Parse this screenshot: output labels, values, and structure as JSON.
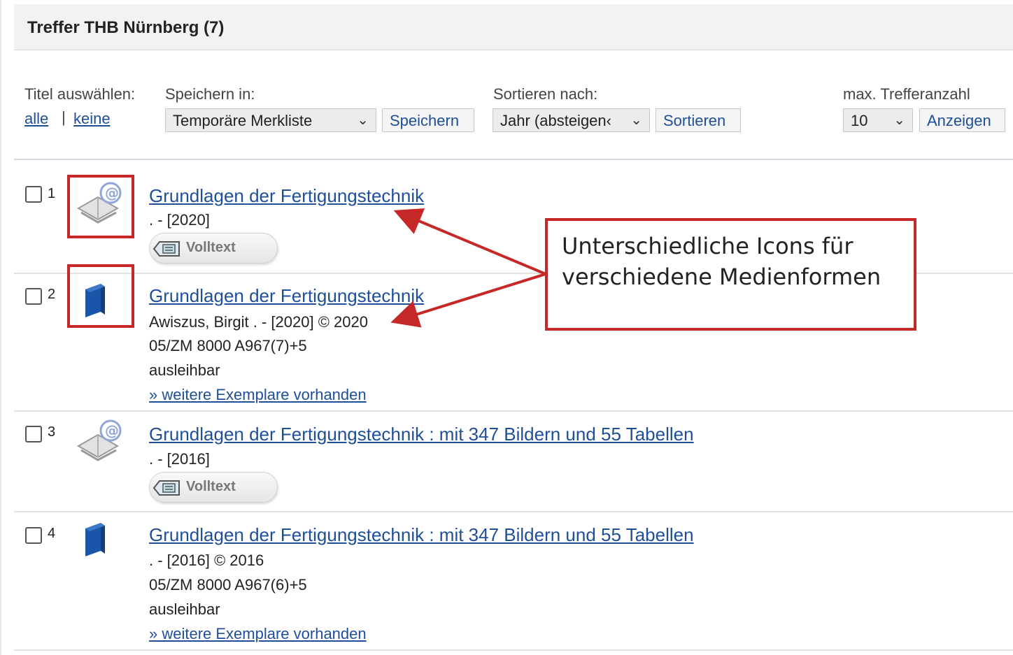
{
  "header": {
    "title": "Treffer THB Nürnberg (7)"
  },
  "controls": {
    "select_titles_label": "Titel auswählen:",
    "select_all": "alle",
    "separator": "|",
    "select_none": "keine",
    "save_label": "Speichern in:",
    "save_target": "Temporäre Merkliste",
    "save_button": "Speichern",
    "sort_label": "Sortieren nach:",
    "sort_value": "Jahr (absteigen‹",
    "sort_button": "Sortieren",
    "max_label": "max. Trefferanzahl",
    "max_value": "10",
    "show_button": "Anzeigen"
  },
  "results": [
    {
      "number": "1",
      "media_icon": "e-book-icon",
      "title": "Grundlagen der Fertigungstechnik",
      "line1": ". - [2020]",
      "badge": "Volltext"
    },
    {
      "number": "2",
      "media_icon": "book-icon",
      "title": "Grundlagen der Fertigungstechnik",
      "line1": "Awiszus, Birgit . - [2020] © 2020",
      "line2": "05/ZM 8000 A967(7)+5",
      "line3": "ausleihbar",
      "more_link": "» weitere Exemplare vorhanden"
    },
    {
      "number": "3",
      "media_icon": "e-book-icon",
      "title": "Grundlagen der Fertigungstechnik : mit 347 Bildern und 55 Tabellen",
      "line1": ". - [2016]",
      "badge": "Volltext"
    },
    {
      "number": "4",
      "media_icon": "book-icon",
      "title": "Grundlagen der Fertigungstechnik : mit 347 Bildern und 55 Tabellen",
      "line1": ". - [2016] © 2016",
      "line2": "05/ZM 8000 A967(6)+5",
      "line3": "ausleihbar",
      "more_link": "» weitere Exemplare vorhanden"
    }
  ],
  "annotation": {
    "text": "Unterschiedliche Icons für verschiedene Medienformen",
    "color": "#c62828"
  },
  "colors": {
    "link": "#1f4f99",
    "header_bg": "#f2f2f2",
    "book_blue": "#1b55a8"
  }
}
